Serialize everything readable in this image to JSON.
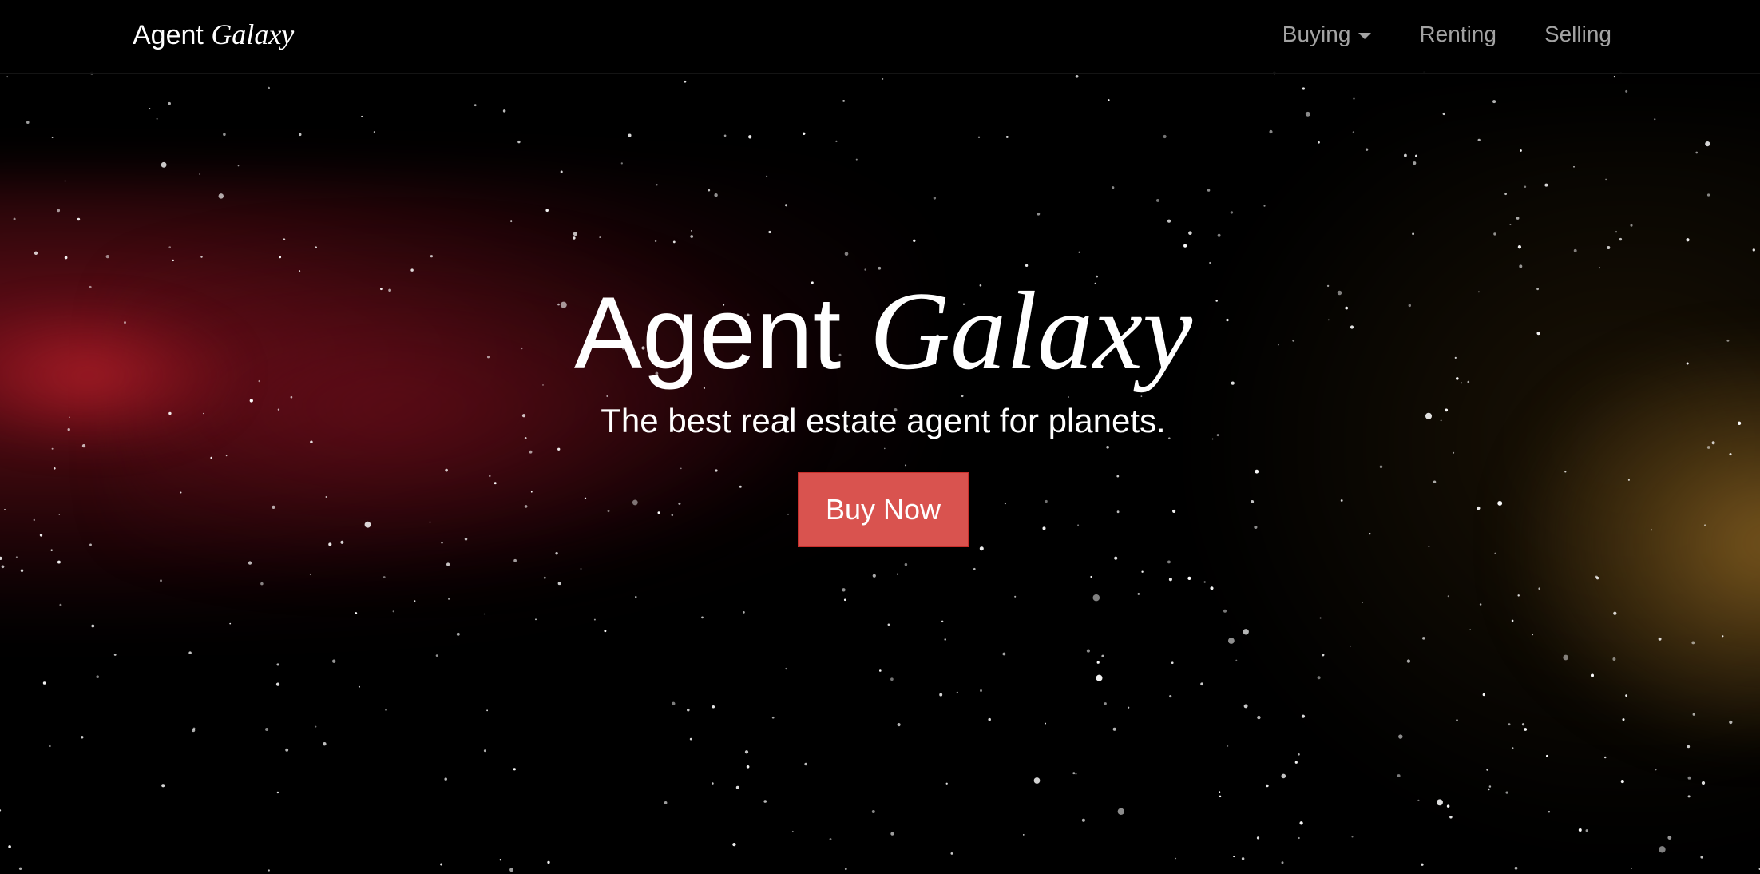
{
  "navbar": {
    "brand_plain": "Agent",
    "brand_italic": "Galaxy",
    "items": [
      {
        "label": "Buying",
        "has_dropdown": true
      },
      {
        "label": "Renting"
      },
      {
        "label": "Selling"
      }
    ]
  },
  "hero": {
    "title_plain": "Agent",
    "title_italic": "Galaxy",
    "subtitle": "The best real estate agent for planets.",
    "cta_label": "Buy Now"
  },
  "colors": {
    "background": "#000000",
    "cta": "#d9534f",
    "nav_text": "#a3a3a3",
    "nebula_red": "#961423",
    "nebula_gold": "#8c6423"
  },
  "icons": {
    "dropdown": "caret-down-icon"
  }
}
